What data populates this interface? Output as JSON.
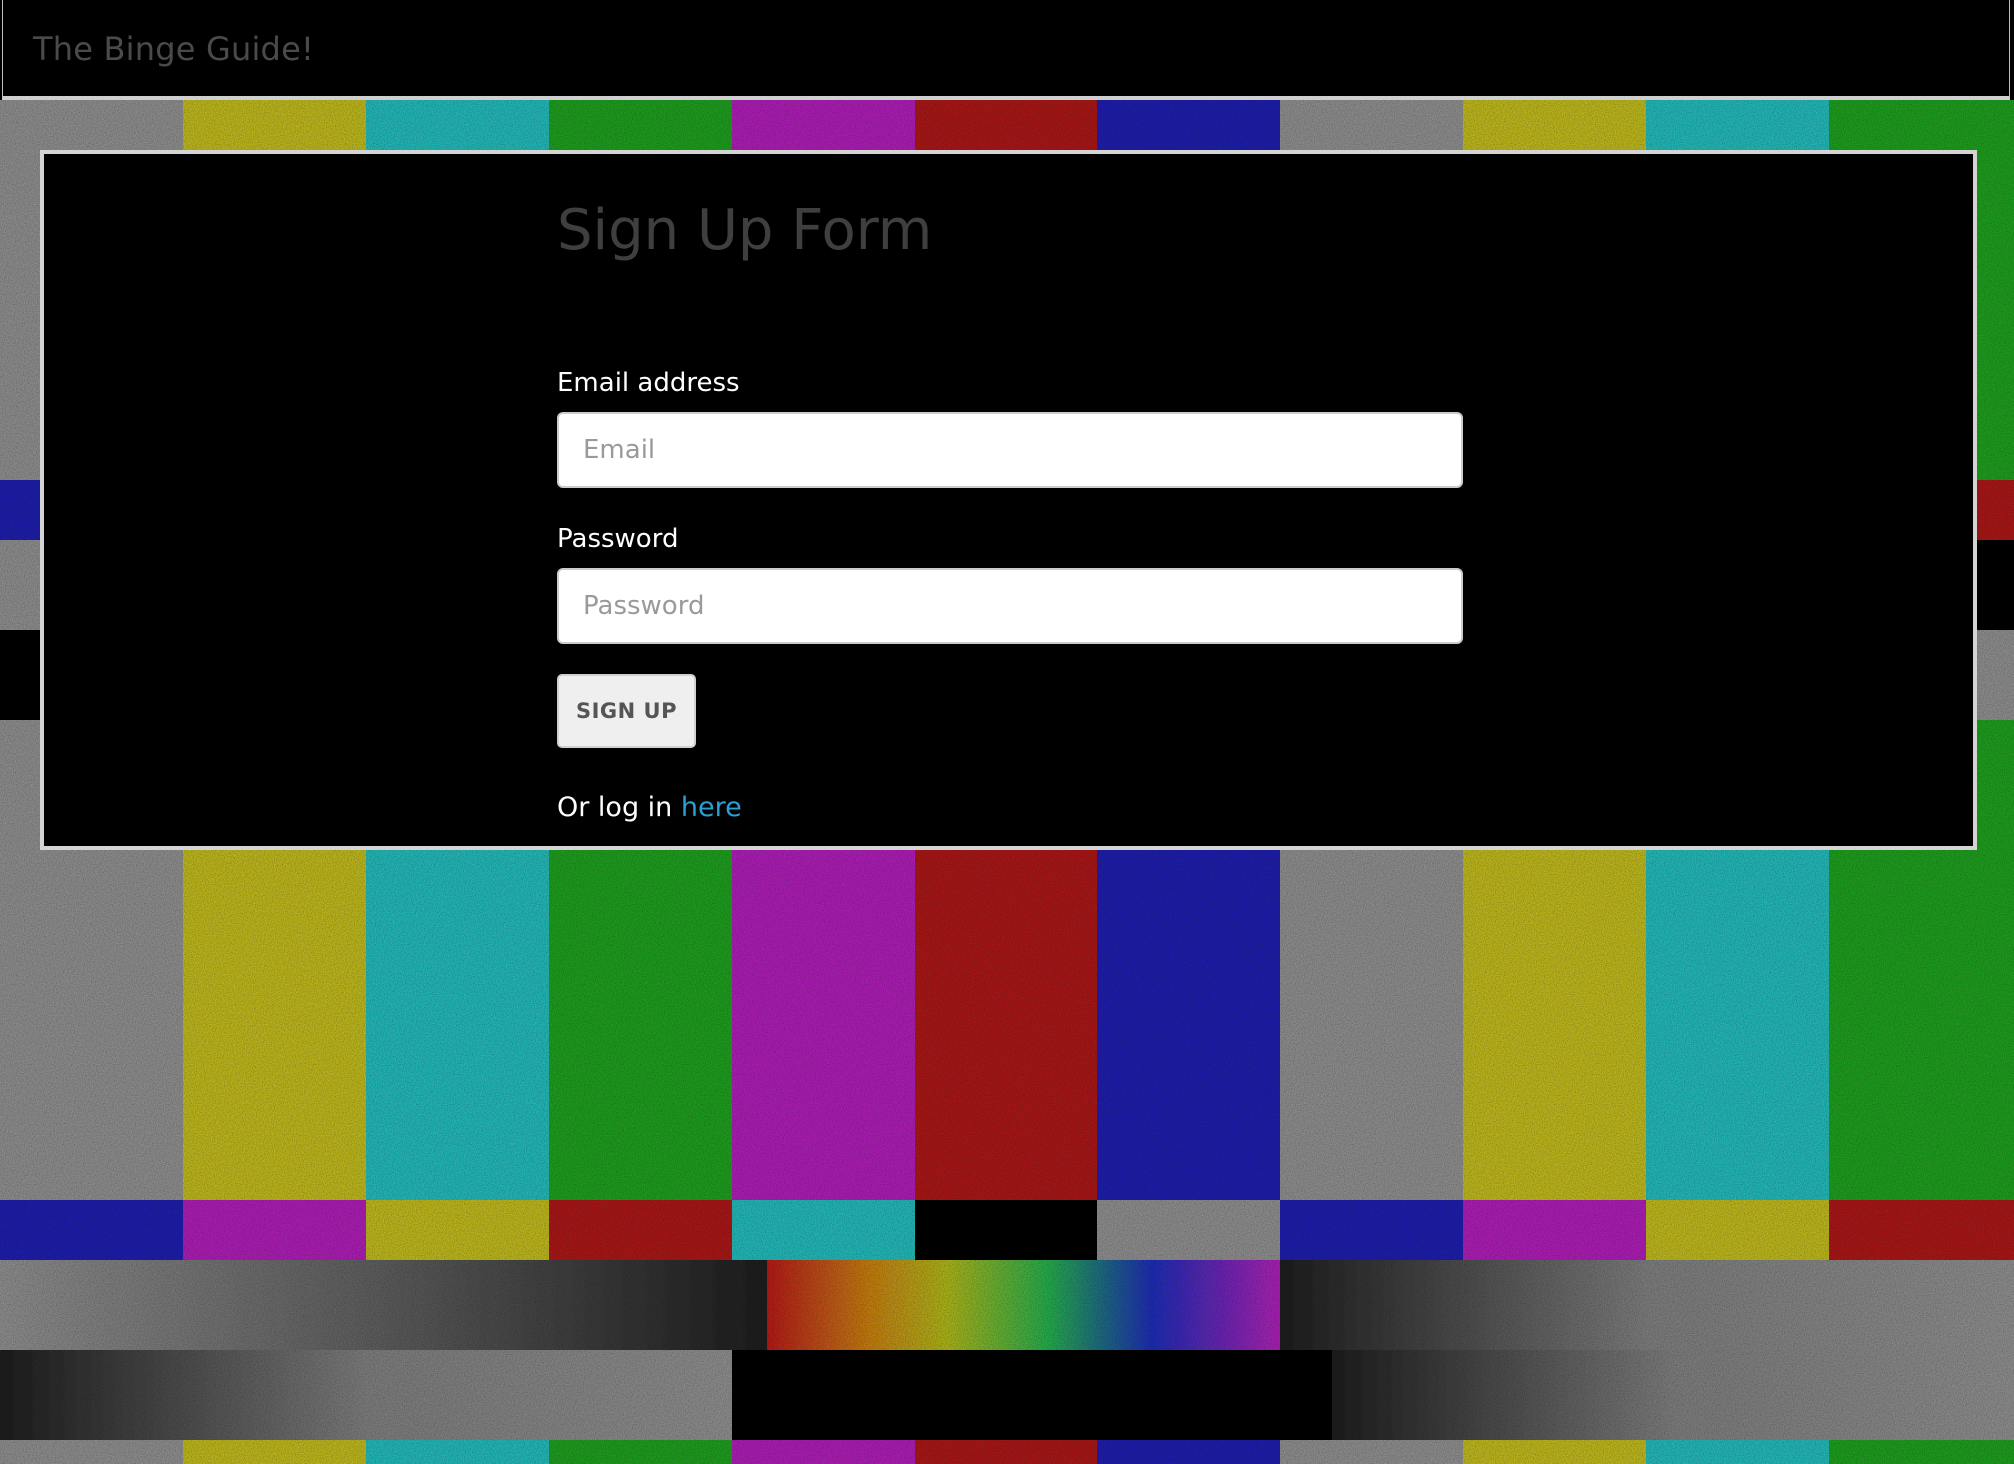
{
  "navbar": {
    "brand": "The Binge Guide!"
  },
  "form": {
    "title": "Sign Up Form",
    "email_label": "Email address",
    "email_placeholder": "Email",
    "email_value": "",
    "password_label": "Password",
    "password_placeholder": "Password",
    "password_value": "",
    "submit_label": "SIGN UP",
    "login_prefix": "Or log in",
    "login_link_text": "here"
  },
  "colors": {
    "page_background": "#000000",
    "link": "#2a9fd6",
    "panel_border": "#d4d4d4",
    "pattern_gray": "#8a8a8a",
    "pattern_yellow": "#b9b31c",
    "pattern_cyan": "#22b4b4",
    "pattern_green": "#1e9a1e",
    "pattern_magenta": "#a81fb0",
    "pattern_red": "#a51818",
    "pattern_blue": "#1a1aa8"
  }
}
